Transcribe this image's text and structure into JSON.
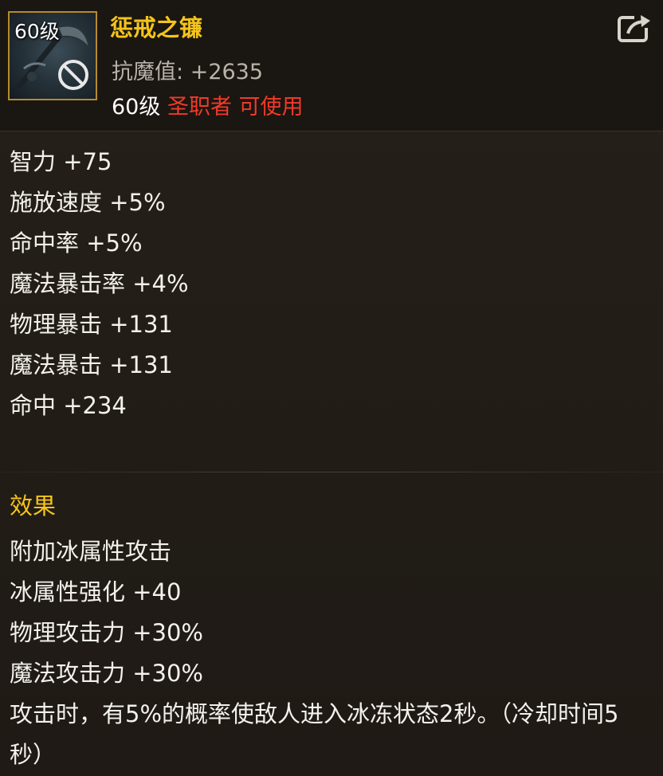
{
  "item": {
    "icon_level": "60级",
    "name": "惩戒之镰",
    "resist_label": "抗魔值:",
    "resist_value": "+2635",
    "req_level": "60级",
    "req_class": "圣职者 可使用",
    "icon": "scythe-weapon-icon",
    "usable_badge_icon": "forbidden-icon",
    "share_icon": "share-icon"
  },
  "stats": [
    "智力 +75",
    "施放速度 +5%",
    "命中率 +5%",
    "魔法暴击率 +4%",
    "物理暴击 +131",
    "魔法暴击 +131",
    "命中 +234"
  ],
  "effect": {
    "title": "效果",
    "lines": [
      "附加冰属性攻击",
      "冰属性强化 +40",
      "物理攻击力 +30%",
      "魔法攻击力 +30%"
    ],
    "proc": "攻击时，有5%的概率使敌人进入冰冻状态2秒。（冷却时间5秒）"
  },
  "colors": {
    "name": "#f5c41a",
    "class_req": "#f03a2a",
    "frame": "#b58a2e",
    "text": "#f4f1ec",
    "muted": "#b9b3aa"
  }
}
